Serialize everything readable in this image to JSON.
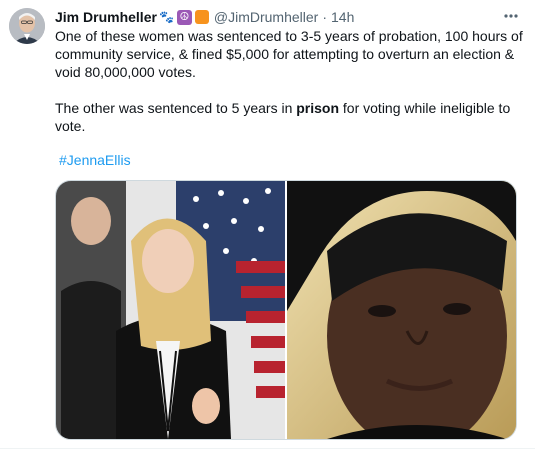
{
  "author": {
    "name": "Jim Drumheller",
    "handle": "@JimDrumheller",
    "time": "14h",
    "badges": [
      "paw-prints-icon",
      "peace-icon",
      "orange-square-icon"
    ]
  },
  "tweet": {
    "paragraph1": "One of these women was sentenced to 3-5 years of probation, 100 hours of community service, & fined $5,000 for attempting to overturn an election & void 80,000,000 votes.",
    "paragraph2_before": "The other was sentenced to 5 years in ",
    "paragraph2_bold": "prison",
    "paragraph2_after": " for voting while ineligible to vote.",
    "hashtag": "#JennaEllis"
  },
  "colors": {
    "link": "#1d9bf0",
    "secondary_text": "#536471",
    "primary_text": "#0f1419"
  }
}
